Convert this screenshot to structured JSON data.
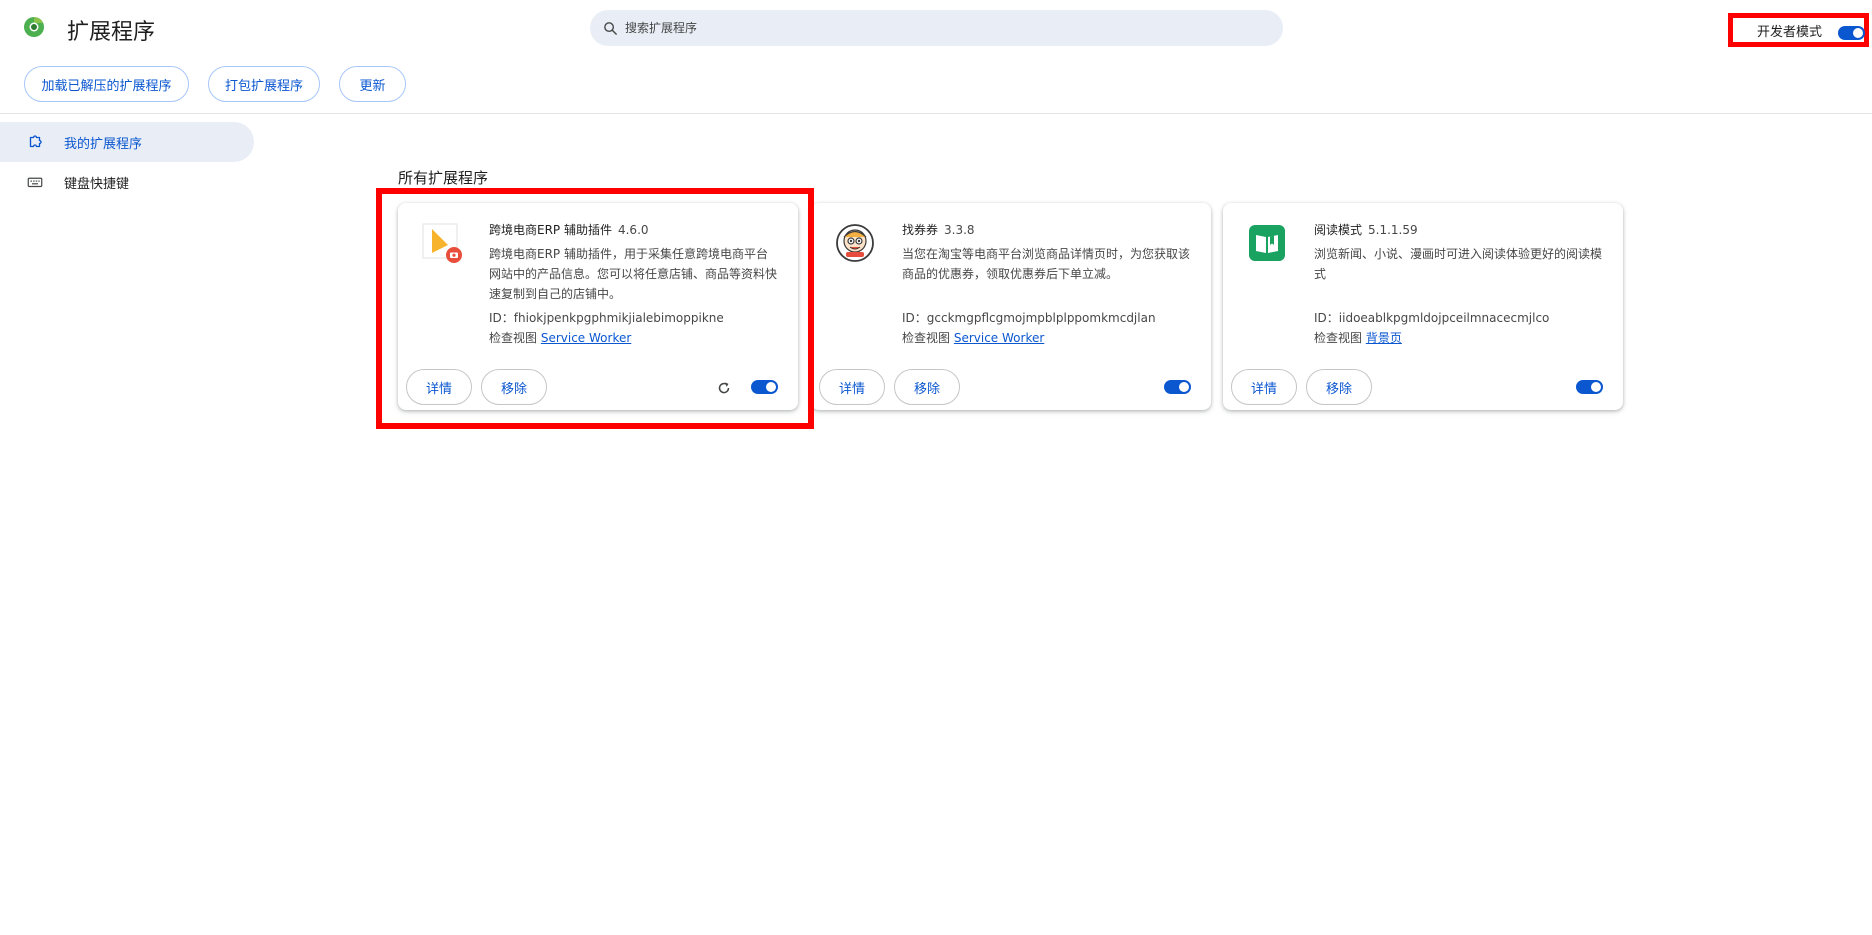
{
  "header": {
    "title": "扩展程序",
    "search_placeholder": "搜索扩展程序",
    "dev_mode_label": "开发者模式",
    "dev_mode_on": true
  },
  "toolbar": {
    "load_unpacked": "加载已解压的扩展程序",
    "pack": "打包扩展程序",
    "update": "更新"
  },
  "sidebar": {
    "items": [
      {
        "label": "我的扩展程序",
        "icon": "puzzle-icon",
        "active": true
      },
      {
        "label": "键盘快捷键",
        "icon": "keyboard-icon",
        "active": false
      }
    ]
  },
  "main": {
    "section_title": "所有扩展程序",
    "extensions": [
      {
        "name": "跨境电商ERP 辅助插件",
        "version": "4.6.0",
        "description": "跨境电商ERP 辅助插件，用于采集任意跨境电商平台网站中的产品信息。您可以将任意店铺、商品等资料快速复制到自己的店铺中。",
        "id": "ID：fhiokjpenkpgphmikjialebimoppikne",
        "inspect_label": "检查视图",
        "inspect_link": "Service Worker",
        "details": "详情",
        "remove": "移除",
        "enabled": true,
        "icon": "erp-plugin-icon"
      },
      {
        "name": "找券券",
        "version": "3.3.8",
        "description": "当您在淘宝等电商平台浏览商品详情页时，为您获取该商品的优惠券，领取优惠券后下单立减。",
        "id": "ID：gcckmgpflcgmojmpblplppomkmcdjlan",
        "inspect_label": "检查视图",
        "inspect_link": "Service Worker",
        "details": "详情",
        "remove": "移除",
        "enabled": true,
        "icon": "coupon-mascot-icon"
      },
      {
        "name": "阅读模式",
        "version": "5.1.1.59",
        "description": "浏览新闻、小说、漫画时可进入阅读体验更好的阅读模式",
        "id": "ID：iidoeablkpgmldojpceilmnacecmjlco",
        "inspect_label": "检查视图",
        "inspect_link": "背景页",
        "details": "详情",
        "remove": "移除",
        "enabled": true,
        "icon": "book-icon"
      }
    ]
  },
  "colors": {
    "accent": "#0b57d0",
    "highlight": "#ff0000",
    "search_bg": "#e9eef6"
  }
}
